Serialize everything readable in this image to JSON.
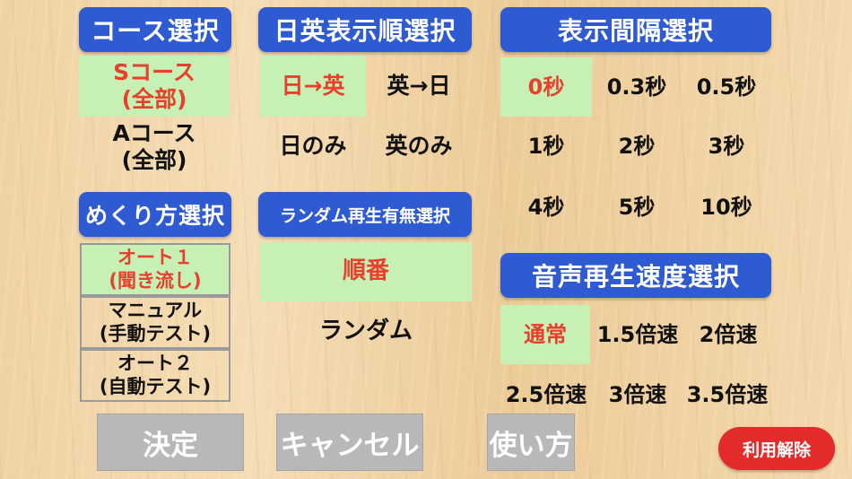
{
  "headers": {
    "course": "コース選択",
    "order": "日英表示順選択",
    "interval": "表示間隔選択",
    "flip": "めくり方選択",
    "random": "ランダム再生有無選択",
    "speed": "音声再生速度選択"
  },
  "course_options": [
    {
      "line1": "Sコース",
      "line2": "(全部)"
    },
    {
      "line1": "Aコース",
      "line2": "(全部)"
    }
  ],
  "order_options": [
    "日→英",
    "英→日",
    "日のみ",
    "英のみ"
  ],
  "interval_options": [
    "0秒",
    "0.3秒",
    "0.5秒",
    "1秒",
    "2秒",
    "3秒",
    "4秒",
    "5秒",
    "10秒"
  ],
  "flip_options": [
    {
      "line1": "オート１",
      "line2": "(聞き流し)"
    },
    {
      "line1": "マニュアル",
      "line2": "(手動テスト)"
    },
    {
      "line1": "オート２",
      "line2": "(自動テスト)"
    }
  ],
  "random_options": [
    "順番",
    "ランダム"
  ],
  "speed_options": [
    "通常",
    "1.5倍速",
    "2倍速",
    "2.5倍速",
    "3倍速",
    "3.5倍速"
  ],
  "buttons": {
    "decide": "決定",
    "cancel": "キャンセル",
    "howto": "使い方",
    "unsubscribe": "利用解除"
  },
  "colors": {
    "header_bg": "#2f5bd2",
    "selected_bg": "#c6f0b4",
    "selected_text": "#e8402d",
    "button_bg": "#b8b8b8",
    "unsubscribe_bg": "#e32b2b"
  }
}
